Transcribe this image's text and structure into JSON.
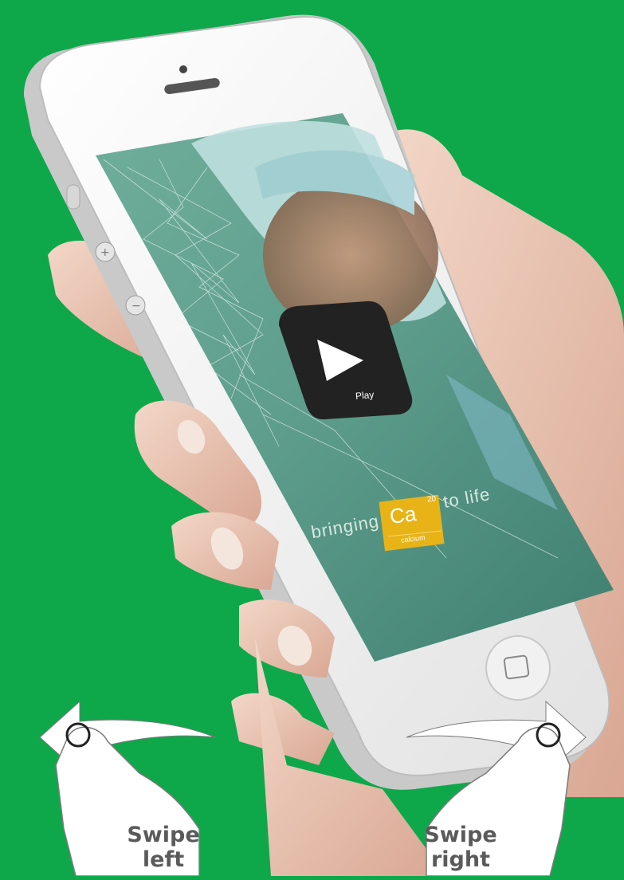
{
  "background_color": "#0ea84b",
  "app_screen": {
    "play_button_label": "Play",
    "tagline_before": "bringing",
    "tagline_after": "to life",
    "element": {
      "symbol": "Ca",
      "atomic_number": "20",
      "name": "calcium",
      "color": "#e8b316"
    }
  },
  "gestures": {
    "left": {
      "line1": "Swipe",
      "line2": "left",
      "icon": "swipe-left-hand-icon"
    },
    "right": {
      "line1": "Swipe",
      "line2": "right",
      "icon": "swipe-right-hand-icon"
    }
  }
}
